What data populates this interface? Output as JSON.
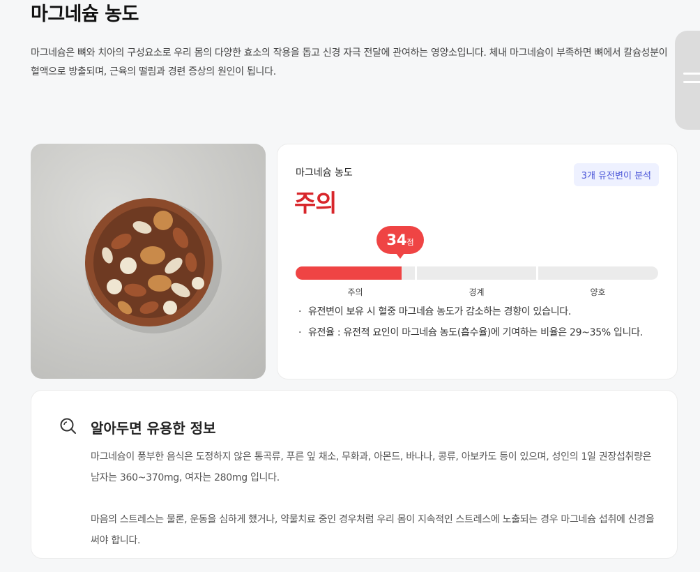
{
  "page": {
    "title": "마그네슘 농도",
    "intro": "마그네슘은 뼈와 치아의 구성요소로 우리 몸의 다양한 효소의 작용을 돕고 신경 자극 전달에 관여하는 영양소입니다. 체내 마그네슘이 부족하면 뼈에서 칼슘성분이 혈액으로 방출되며, 근육의 떨림과 경련 증상의 원인이 됩니다."
  },
  "result": {
    "label": "마그네슘 농도",
    "badge": "3개 유전변이 분석",
    "status": "주의",
    "score": "34",
    "score_unit": "점",
    "score_fraction": 0.34,
    "segments": [
      "주의",
      "경계",
      "양호"
    ],
    "bullets": [
      "유전변이 보유 시 혈중 마그네슘 농도가 감소하는 경향이 있습니다.",
      "유전율 : 유전적 요인이 마그네슘 농도(흡수율)에 기여하는 비율은 29~35% 입니다."
    ]
  },
  "info": {
    "title": "알아두면 유용한 정보",
    "paragraphs": [
      "마그네슘이 풍부한 음식은 도정하지 않은 통곡류, 푸른 잎 채소, 무화과, 아몬드, 바나나, 콩류, 아보카도 등이 있으며, 성인의 1일 권장섭취량은 남자는 360~370mg, 여자는 280mg 입니다.",
      "마음의 스트레스는 물론, 운동을 심하게 했거나, 약물치료 중인 경우처럼 우리 몸이 지속적인 스트레스에 노출되는 경우 마그네슘 섭취에 신경을 써야 합니다."
    ]
  },
  "colors": {
    "danger": "#ef4444",
    "status_red": "#d8262b",
    "badge_text": "#4a55d8",
    "badge_bg": "#eef1ff"
  },
  "icons": {
    "info": "search-icon",
    "menu": "menu-icon"
  }
}
